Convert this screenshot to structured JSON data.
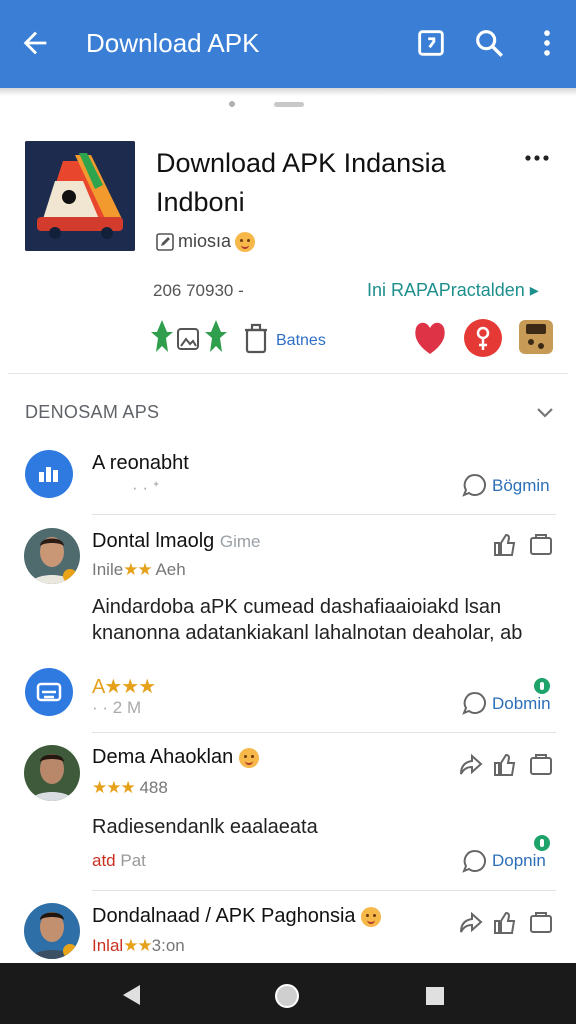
{
  "appbar": {
    "title": "Download APK"
  },
  "app": {
    "name": "Download APK Indansia Indboni",
    "developer": "miosıa",
    "count": "206 70930 -",
    "link": "Ini RAPAPractalden ▸",
    "ratings_label": "Batnes"
  },
  "section": {
    "title": "DENOSAM APS"
  },
  "items": [
    {
      "name": "A reonabht",
      "sub": "· · ᐩ",
      "action": "Bögmin"
    },
    {
      "name": "Dontal lmaolg",
      "name_suffix": "Gime",
      "sub_prefix": "Inile",
      "stars": "★★",
      "sub_suffix": "Aeh",
      "body": "Aindardoba aPK cumead dashafiaaioiakd lsan knanonna adatankiakanl lahalnotan deaholar, ab"
    },
    {
      "stars": "A★★★",
      "sub": "· · 2 M",
      "action": "Dobmin"
    },
    {
      "name": "Dema Ahaoklan",
      "stars": "★★★",
      "sub": "488",
      "body": "Radiesendanlk   eaalaeata",
      "tag_red": "atd",
      "tag_gray": "Pat",
      "action": "Dopnin"
    },
    {
      "name": "Dondalnaad / APK Paghonsia",
      "sub_prefix": "Inlal",
      "stars": "★★",
      "sub_suffix": "3:on"
    }
  ]
}
